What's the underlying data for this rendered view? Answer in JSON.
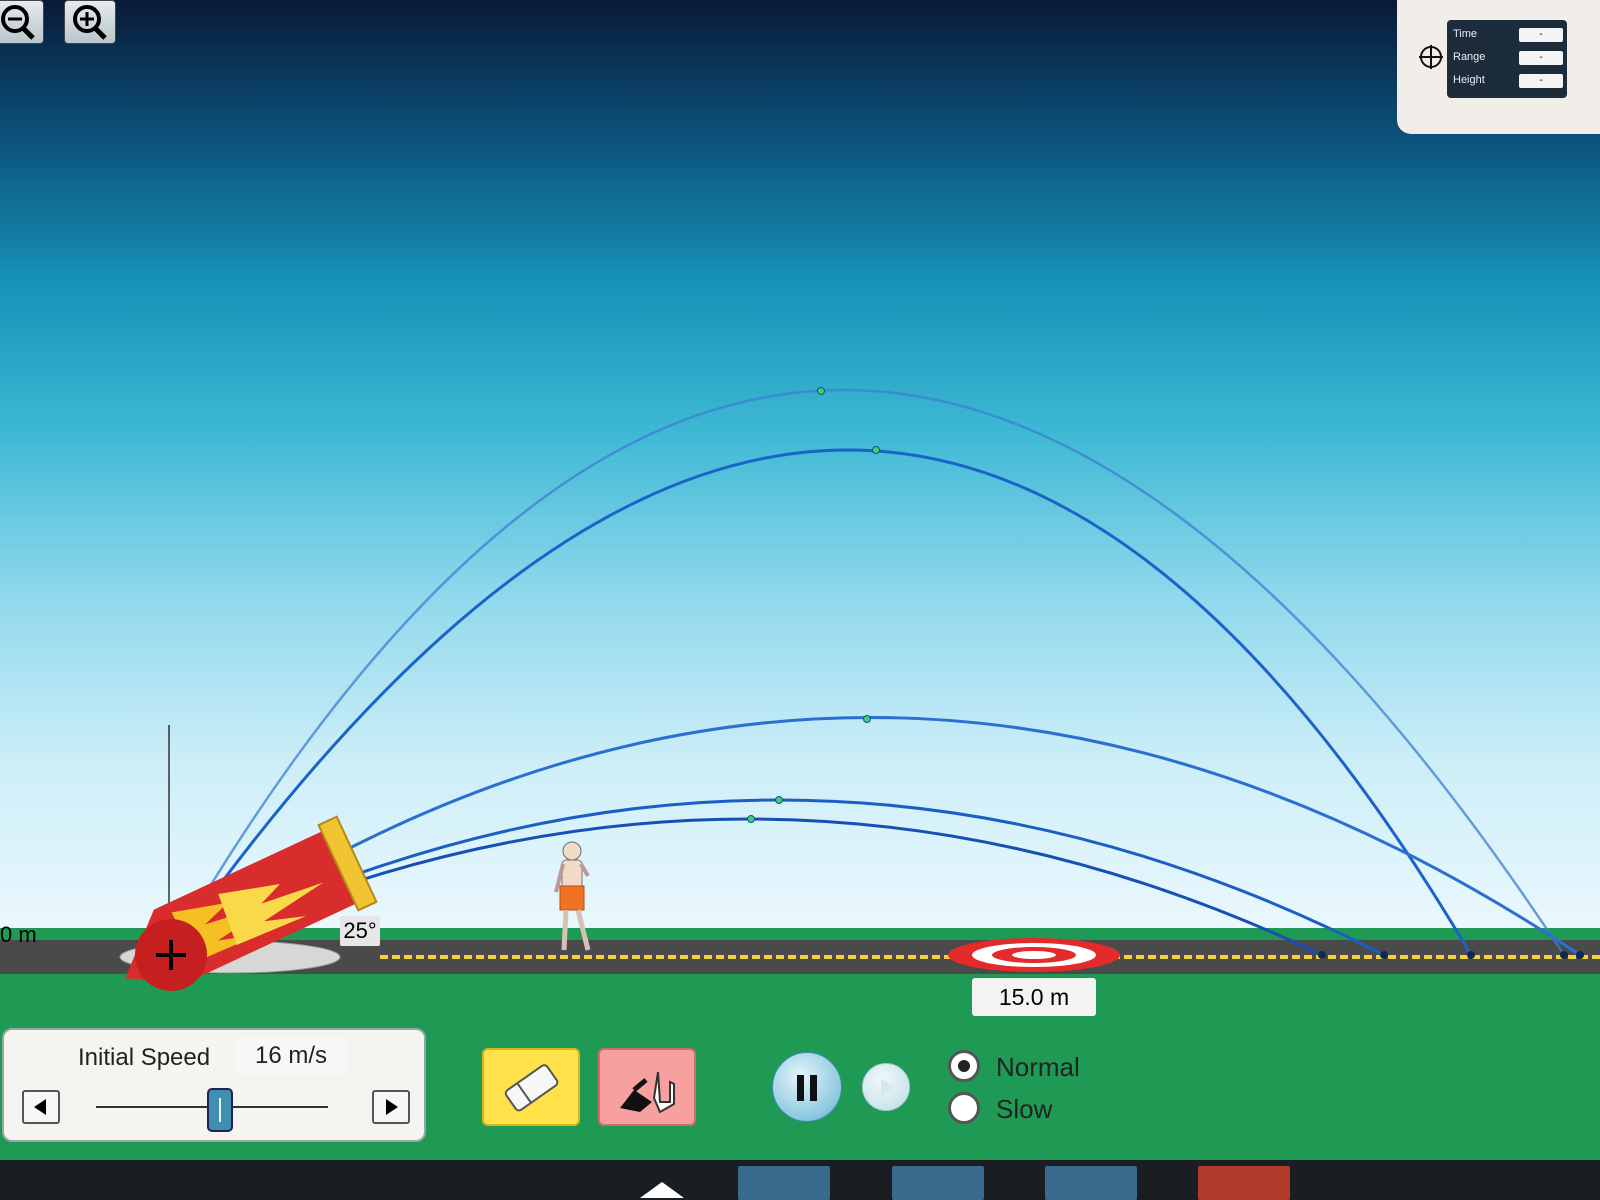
{
  "toolbar": {
    "zoom_out_icon": "zoom-out-magnifier",
    "zoom_in_icon": "zoom-in-magnifier"
  },
  "readout": {
    "time_label": "Time",
    "range_label": "Range",
    "height_label": "Height",
    "time_value": "-",
    "range_value": "-",
    "height_value": "-"
  },
  "scene": {
    "scale_label": "0 m",
    "angle": "25°",
    "target_distance": "15.0 m"
  },
  "controls": {
    "initial_speed_label": "Initial Speed",
    "initial_speed_value": "16 m/s",
    "speed_fraction": 0.52,
    "eraser_icon": "eraser-icon",
    "fire_icon": "fire-cannon-icon",
    "playback": {
      "pause_icon": "pause-icon",
      "step_icon": "step-forward-icon"
    },
    "speed_modes": [
      {
        "label": "Normal",
        "selected": true
      },
      {
        "label": "Slow",
        "selected": false
      }
    ]
  },
  "colors": {
    "trajectory": "#1a5fc4",
    "ground": "#1f9a55",
    "road": "#4a4a4a",
    "lane": "#f4d03f",
    "target_red": "#e32b2b"
  }
}
